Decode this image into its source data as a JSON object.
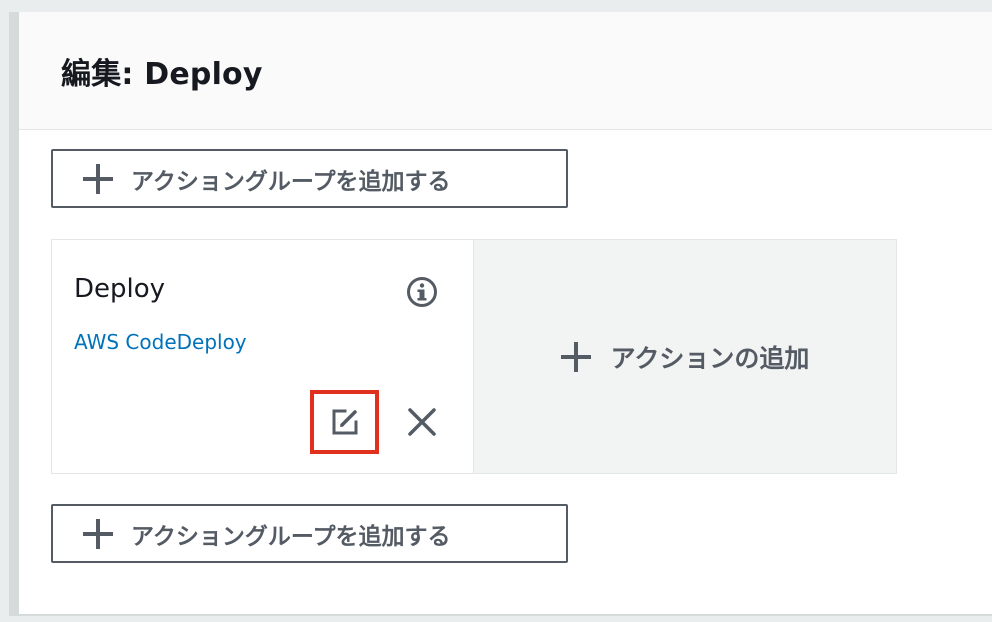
{
  "panel": {
    "title": "編集: Deploy"
  },
  "buttons": {
    "add_action_group": "アクショングループを追加する",
    "add_action": "アクションの追加"
  },
  "action": {
    "name": "Deploy",
    "provider": "AWS CodeDeploy"
  },
  "icons": {
    "info": "info-icon",
    "edit": "edit-icon",
    "close": "close-icon",
    "plus": "plus-icon"
  },
  "colors": {
    "link": "#0073bb",
    "highlight": "#e0301e",
    "button_text": "#545b64"
  }
}
